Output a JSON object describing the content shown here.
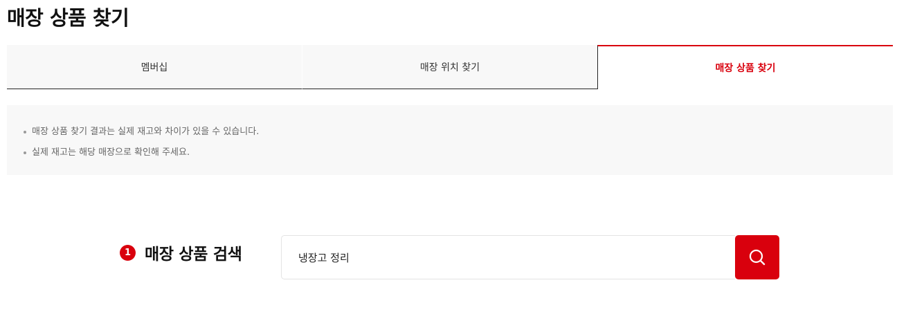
{
  "page": {
    "title": "매장 상품 찾기"
  },
  "tabs": [
    {
      "label": "멤버십",
      "active": false
    },
    {
      "label": "매장 위치 찾기",
      "active": false
    },
    {
      "label": "매장 상품 찾기",
      "active": true
    }
  ],
  "notice": {
    "items": [
      "매장 상품 찾기 결과는 실제 재고와 차이가 있을 수 있습니다.",
      "실제 재고는 해당 매장으로 확인해 주세요."
    ]
  },
  "search": {
    "step_number": "1",
    "label": "매장 상품 검색",
    "value": "냉장고 정리",
    "button_icon": "search-icon"
  },
  "colors": {
    "accent": "#d9000d",
    "notice_bg": "#f8f8f8",
    "tab_bg": "#f8f8f8"
  }
}
